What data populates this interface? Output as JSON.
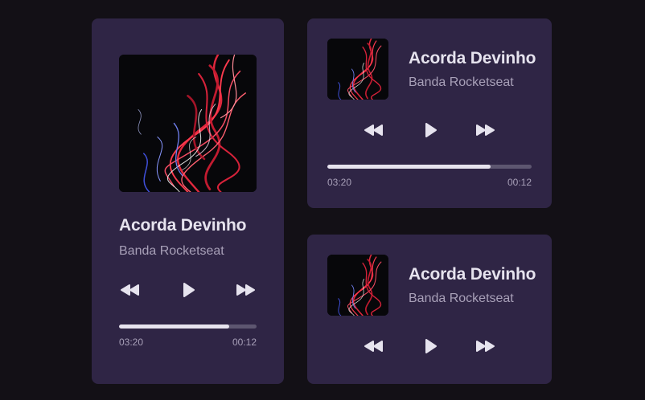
{
  "players": [
    {
      "variant": "large",
      "title": "Acorda Devinho",
      "artist": "Banda Rocketseat",
      "current_time": "03:20",
      "end_time": "00:12",
      "progress_fraction": 0.8,
      "controls": {
        "prev": "rewind-icon",
        "play": "play-icon",
        "next": "fast-forward-icon"
      }
    },
    {
      "variant": "compact",
      "title": "Acorda Devinho",
      "artist": "Banda Rocketseat",
      "current_time": "03:20",
      "end_time": "00:12",
      "progress_fraction": 0.8,
      "controls": {
        "prev": "rewind-icon",
        "play": "play-icon",
        "next": "fast-forward-icon"
      }
    },
    {
      "variant": "mini",
      "title": "Acorda Devinho",
      "artist": "Banda Rocketseat",
      "controls": {
        "prev": "rewind-icon",
        "play": "play-icon",
        "next": "fast-forward-icon"
      }
    }
  ],
  "colors": {
    "background": "#131016",
    "card": "#2f2545",
    "text_primary": "#e6e3ee",
    "text_secondary": "#a8a0b8",
    "progress_track": "#5d5670",
    "progress_fill": "#e7e3ee"
  }
}
